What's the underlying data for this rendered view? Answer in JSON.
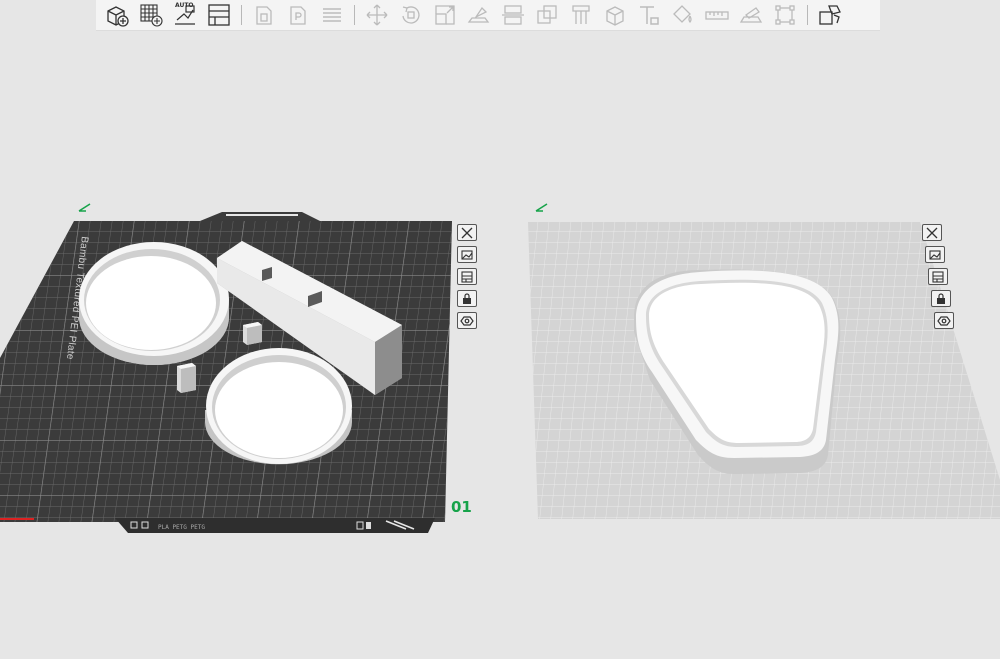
{
  "toolbar": {
    "buttons": [
      {
        "name": "add-object-icon",
        "enabled": true
      },
      {
        "name": "add-plate-icon",
        "enabled": true
      },
      {
        "name": "auto-arrange-icon",
        "enabled": true,
        "tag": "AUTO"
      },
      {
        "name": "plate-layout-icon",
        "enabled": true
      },
      {
        "name": "orient-icon",
        "enabled": false
      },
      {
        "name": "place-face-icon",
        "enabled": false
      },
      {
        "name": "layers-icon",
        "enabled": false
      },
      {
        "name": "move-icon",
        "enabled": false
      },
      {
        "name": "rotate-icon",
        "enabled": false
      },
      {
        "name": "scale-icon",
        "enabled": false
      },
      {
        "name": "lay-on-face-icon",
        "enabled": false
      },
      {
        "name": "cut-icon",
        "enabled": false
      },
      {
        "name": "mesh-boolean-icon",
        "enabled": false
      },
      {
        "name": "support-paint-icon",
        "enabled": false
      },
      {
        "name": "seam-paint-icon",
        "enabled": false
      },
      {
        "name": "text-icon",
        "enabled": false
      },
      {
        "name": "color-paint-icon",
        "enabled": false
      },
      {
        "name": "measure-icon",
        "enabled": false
      },
      {
        "name": "assembly-icon",
        "enabled": false
      },
      {
        "name": "fit-view-icon",
        "enabled": false
      },
      {
        "name": "split-icon",
        "enabled": true
      }
    ]
  },
  "plate1": {
    "label": "Bambu Textured PEI Plate",
    "number": "01",
    "bottom_text": "PLA  PETG  PETG"
  },
  "colors": {
    "plate_dark": "#3b3b3b",
    "plate_light": "#d4d4d4",
    "accent": "#17a34a",
    "background": "#e6e6e6"
  }
}
